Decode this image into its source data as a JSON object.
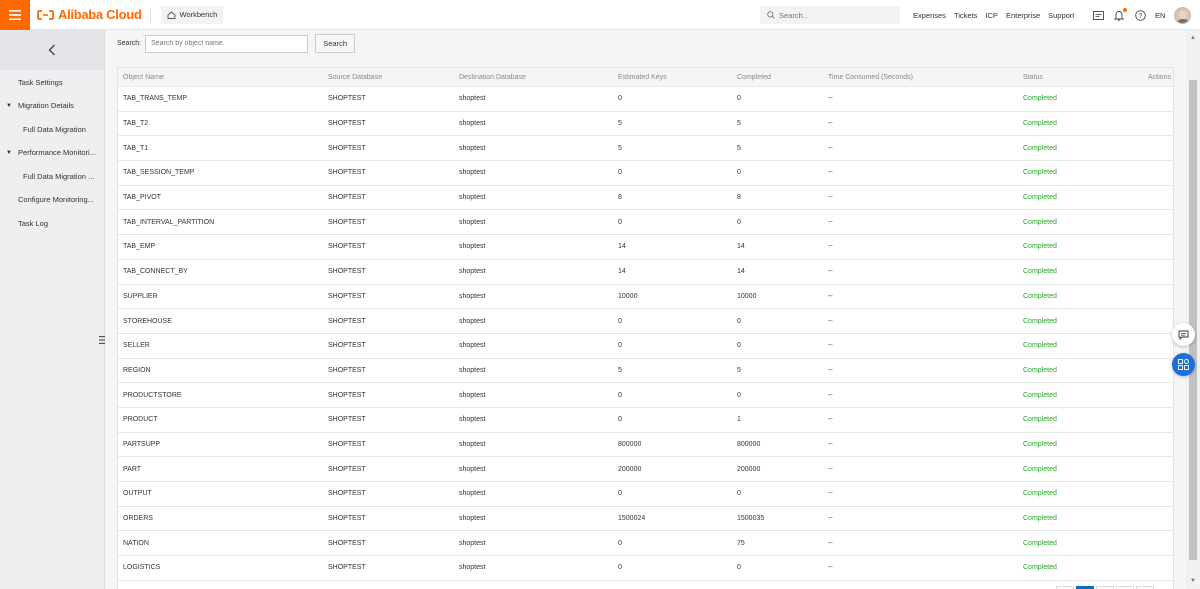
{
  "topbar": {
    "brand": "Alibaba Cloud",
    "workbench_label": "Workbench",
    "search_placeholder": "Search...",
    "links": [
      "Expenses",
      "Tickets",
      "ICP",
      "Enterprise",
      "Support"
    ],
    "language": "EN",
    "accent_color": "#ff6a00"
  },
  "sidebar": {
    "items": [
      {
        "label": "Task Settings"
      },
      {
        "label": "Migration Details"
      },
      {
        "label": "Full Data Migration"
      },
      {
        "label": "Performance Monitori..."
      },
      {
        "label": "Full Data Migration ..."
      },
      {
        "label": "Configure Monitoring..."
      },
      {
        "label": "Task Log"
      }
    ]
  },
  "search": {
    "label": "Search:",
    "placeholder": "Search by object name.",
    "button_label": "Search"
  },
  "table": {
    "headers": [
      "Object Name",
      "Source Database",
      "Destination Database",
      "Estimated Keys",
      "Completed",
      "Time Consumed (Seconds)",
      "Status",
      "Actions"
    ],
    "status_color": "#22a822",
    "rows": [
      [
        "TAB_TRANS_TEMP",
        "SHOPTEST",
        "shoptest",
        "0",
        "0",
        "--",
        "Completed",
        ""
      ],
      [
        "TAB_T2",
        "SHOPTEST",
        "shoptest",
        "5",
        "5",
        "--",
        "Completed",
        ""
      ],
      [
        "TAB_T1",
        "SHOPTEST",
        "shoptest",
        "5",
        "5",
        "--",
        "Completed",
        ""
      ],
      [
        "TAB_SESSION_TEMP",
        "SHOPTEST",
        "shoptest",
        "0",
        "0",
        "--",
        "Completed",
        ""
      ],
      [
        "TAB_PIVOT",
        "SHOPTEST",
        "shoptest",
        "8",
        "8",
        "--",
        "Completed",
        ""
      ],
      [
        "TAB_INTERVAL_PARTITION",
        "SHOPTEST",
        "shoptest",
        "0",
        "0",
        "--",
        "Completed",
        ""
      ],
      [
        "TAB_EMP",
        "SHOPTEST",
        "shoptest",
        "14",
        "14",
        "--",
        "Completed",
        ""
      ],
      [
        "TAB_CONNECT_BY",
        "SHOPTEST",
        "shoptest",
        "14",
        "14",
        "--",
        "Completed",
        ""
      ],
      [
        "SUPPLIER",
        "SHOPTEST",
        "shoptest",
        "10000",
        "10000",
        "--",
        "Completed",
        ""
      ],
      [
        "STOREHOUSE",
        "SHOPTEST",
        "shoptest",
        "0",
        "0",
        "--",
        "Completed",
        ""
      ],
      [
        "SELLER",
        "SHOPTEST",
        "shoptest",
        "0",
        "0",
        "--",
        "Completed",
        ""
      ],
      [
        "REGION",
        "SHOPTEST",
        "shoptest",
        "5",
        "5",
        "--",
        "Completed",
        ""
      ],
      [
        "PRODUCTSTORE",
        "SHOPTEST",
        "shoptest",
        "0",
        "0",
        "--",
        "Completed",
        ""
      ],
      [
        "PRODUCT",
        "SHOPTEST",
        "shoptest",
        "0",
        "1",
        "--",
        "Completed",
        ""
      ],
      [
        "PARTSUPP",
        "SHOPTEST",
        "shoptest",
        "800000",
        "800000",
        "--",
        "Completed",
        ""
      ],
      [
        "PART",
        "SHOPTEST",
        "shoptest",
        "200000",
        "200000",
        "--",
        "Completed",
        ""
      ],
      [
        "OUTPUT",
        "SHOPTEST",
        "shoptest",
        "0",
        "0",
        "--",
        "Completed",
        ""
      ],
      [
        "ORDERS",
        "SHOPTEST",
        "shoptest",
        "1500024",
        "1500035",
        "--",
        "Completed",
        ""
      ],
      [
        "NATION",
        "SHOPTEST",
        "shoptest",
        "0",
        "75",
        "--",
        "Completed",
        ""
      ],
      [
        "LOGISTICS",
        "SHOPTEST",
        "shoptest",
        "0",
        "0",
        "--",
        "Completed",
        ""
      ]
    ]
  }
}
